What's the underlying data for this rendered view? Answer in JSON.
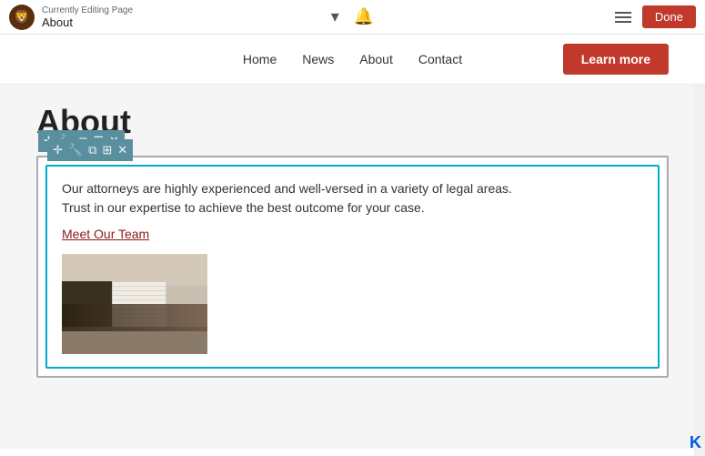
{
  "topbar": {
    "editing_label": "Currently Editing Page",
    "page_name": "About",
    "done_label": "Done"
  },
  "nav": {
    "home": "Home",
    "news": "News",
    "about": "About",
    "contact": "Contact",
    "learn_more": "Learn more"
  },
  "main": {
    "page_title": "About",
    "content_text_line1": "Our attorneys are highly experienced and well-versed in a variety of legal areas.",
    "content_text_line2": "Trust in our expertise to achieve the best outcome for your case.",
    "meet_link": "Meet Our Team"
  },
  "toolbar": {
    "icons": [
      "✛",
      "✎",
      "⧉",
      "☰",
      "✕"
    ]
  }
}
